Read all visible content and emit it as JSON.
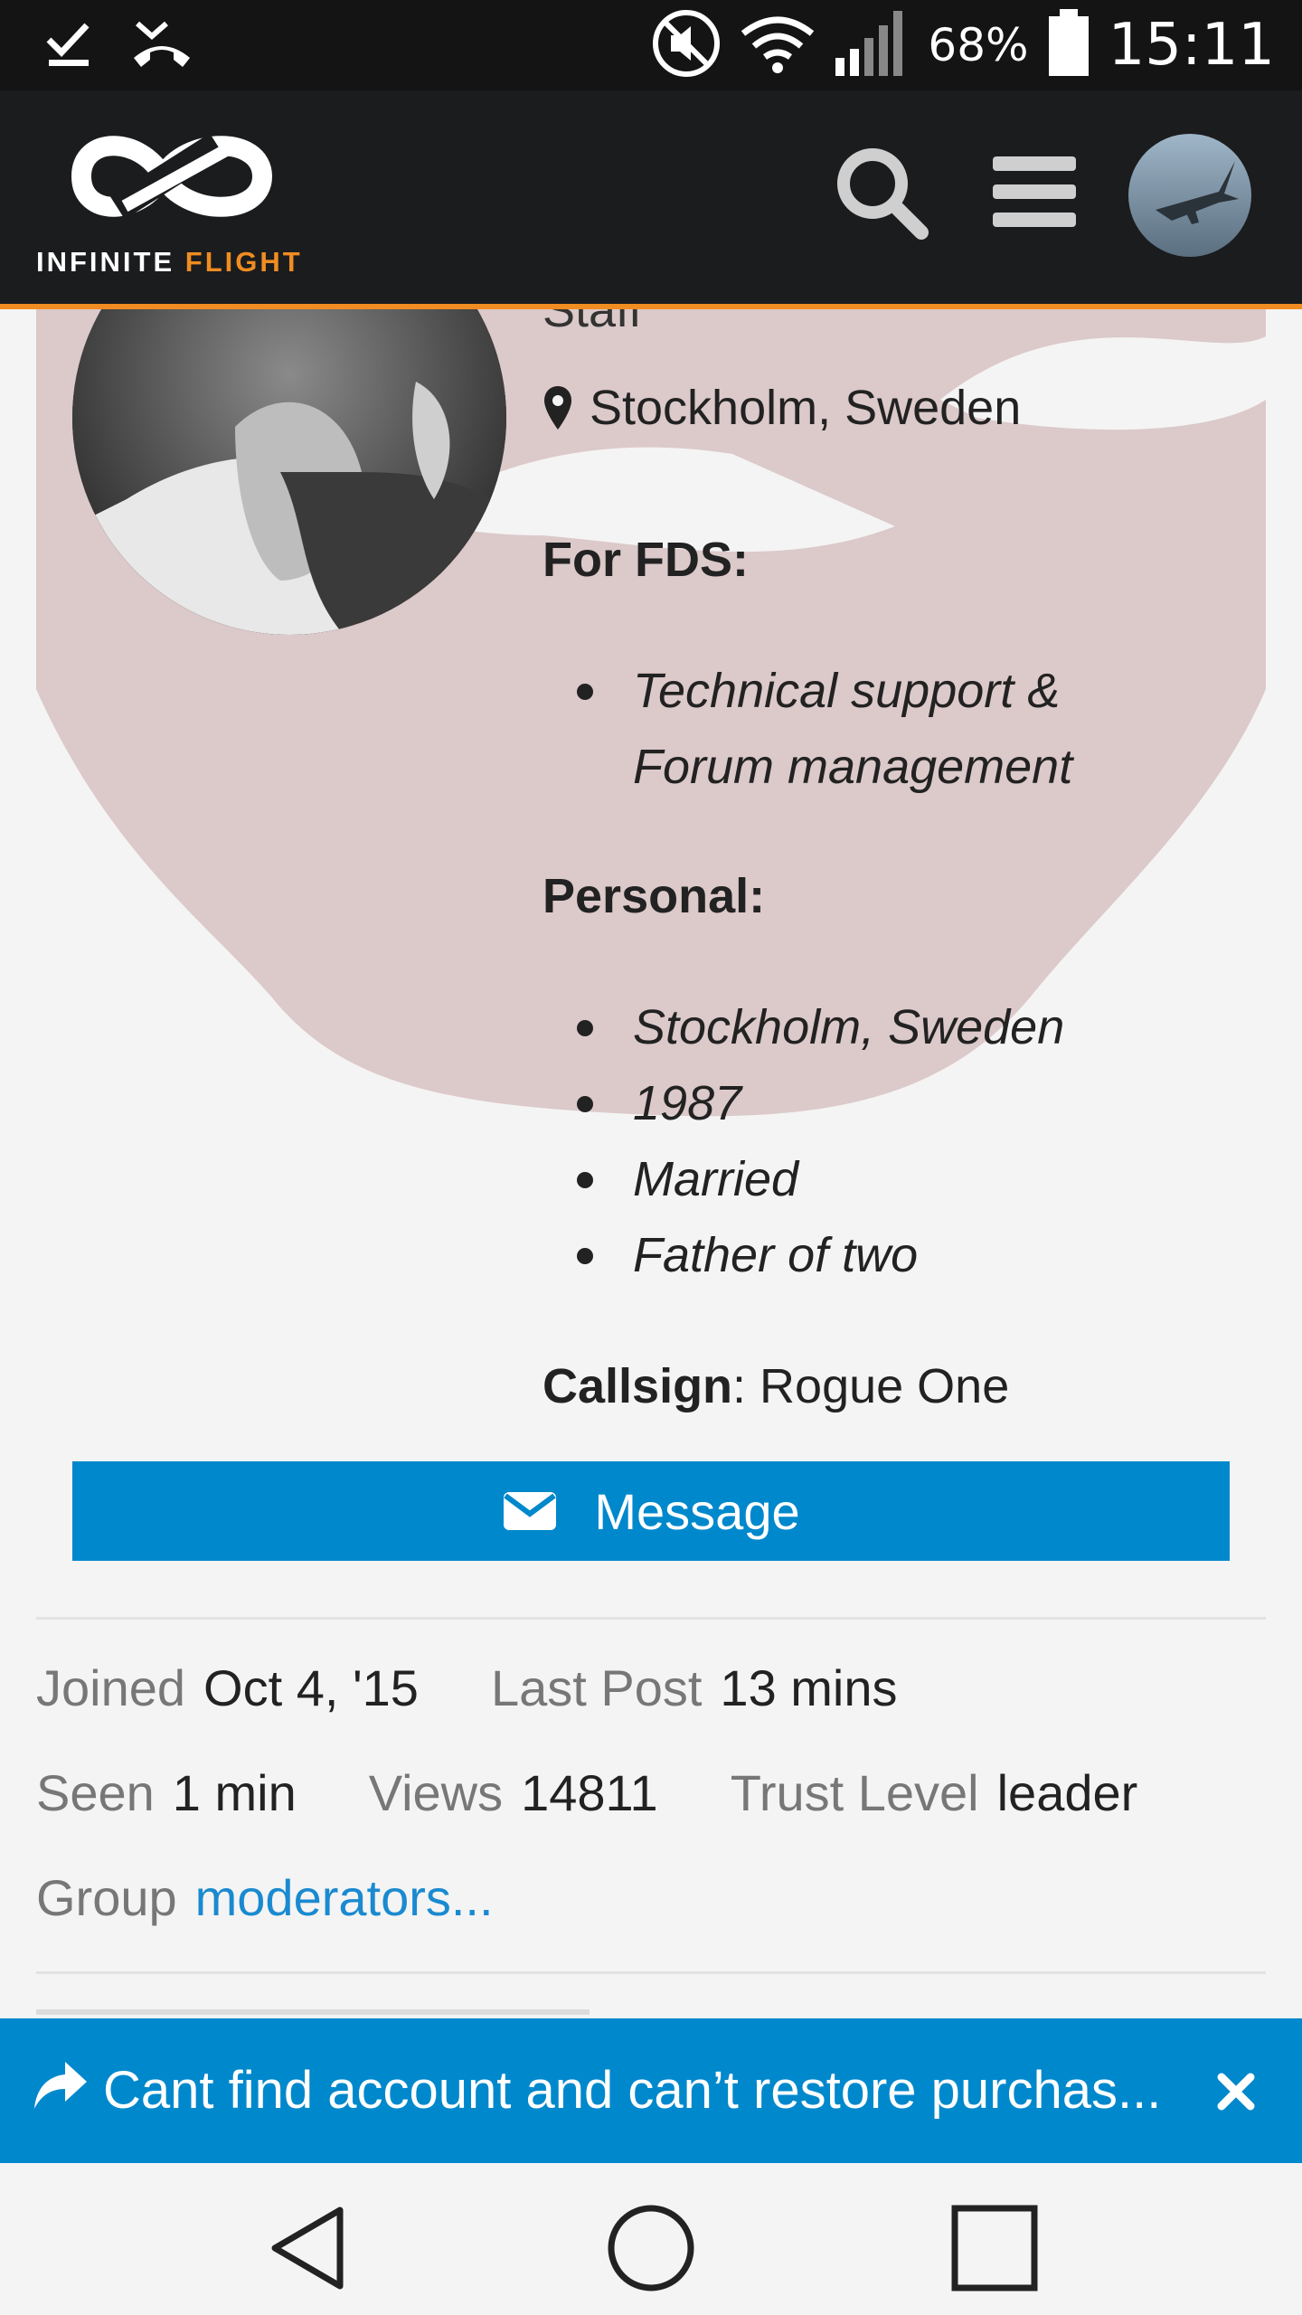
{
  "status_bar": {
    "icons_left": [
      "download-done-icon",
      "missed-call-icon"
    ],
    "icons_right": [
      "mute-icon",
      "wifi-icon",
      "signal-icon",
      "battery-icon"
    ],
    "battery": "68%",
    "time": "15:11"
  },
  "header": {
    "logo_text_main": "INFINITE ",
    "logo_text_accent": "FLIGHT",
    "search_icon": "search-icon",
    "menu_icon": "hamburger-menu-icon",
    "accent_color": "#f08c21"
  },
  "profile": {
    "title": "Staff",
    "location": "Stockholm, Sweden",
    "sections": [
      {
        "heading": "For FDS:",
        "items": [
          "Technical support &",
          "Forum management"
        ]
      },
      {
        "heading": "Personal:",
        "items": [
          "Stockholm, Sweden",
          "1987",
          "Married",
          "Father of two"
        ]
      }
    ],
    "callsign_label": "Callsign",
    "callsign_value": ": Rogue One",
    "message_button": "Message"
  },
  "stats": {
    "joined_label": "Joined",
    "joined_value": "Oct 4, '15",
    "last_post_label": "Last Post",
    "last_post_value": "13 mins",
    "seen_label": "Seen",
    "seen_value": "1 min",
    "views_label": "Views",
    "views_value": "14811",
    "trust_label": "Trust Level",
    "trust_value": "leader",
    "group_label": "Group",
    "group_value": "moderators..."
  },
  "banner": {
    "text": "Cant find account and can’t restore purchas...",
    "color": "#0088cc"
  },
  "nav": {
    "back": "back-icon",
    "home": "home-icon",
    "recents": "recents-icon"
  }
}
